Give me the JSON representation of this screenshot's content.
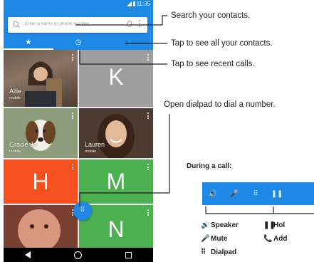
{
  "status_bar": {
    "time": "11:35"
  },
  "search": {
    "placeholder": "Enter a name or phone number"
  },
  "tabs": [
    {
      "icon": "star-icon",
      "glyph": "★"
    },
    {
      "icon": "clock-icon",
      "glyph": "◷"
    },
    {
      "icon": "people-icon",
      "glyph": "👥"
    }
  ],
  "contacts": {
    "allie": {
      "name": "Allie",
      "sub": "mobile"
    },
    "k_letter": "K",
    "gracie": {
      "name": "Gracie Jo",
      "sub": "mobile"
    },
    "lauren": {
      "name": "Lauren",
      "sub": "mobile"
    },
    "h_letter": "H",
    "m_letter": "M",
    "n_letter": "N"
  },
  "fab": {
    "icon": "dialpad-icon",
    "glyph": "⠿"
  },
  "callouts": {
    "search": "Search your contacts.",
    "all_contacts": "Tap to see all your contacts.",
    "recent": "Tap to see recent calls.",
    "dialpad": "Open dialpad to dial a number."
  },
  "during_call": {
    "title": "During a call:",
    "items": [
      {
        "icon": "speaker-icon",
        "glyph": "🔊",
        "label": "Speaker"
      },
      {
        "icon": "hold-icon",
        "glyph": "❚❚",
        "label": "Hol"
      },
      {
        "icon": "mute-icon",
        "glyph": "🎤",
        "label": "Mute"
      },
      {
        "icon": "add-call-icon",
        "glyph": "📞",
        "label": "Add"
      },
      {
        "icon": "dialpad-icon",
        "glyph": "⠿",
        "label": "Dialpad"
      }
    ]
  },
  "colors": {
    "primary": "#1e88e5",
    "orange": "#f4511e",
    "green": "#4caf50",
    "gray": "#9e9e9e"
  }
}
